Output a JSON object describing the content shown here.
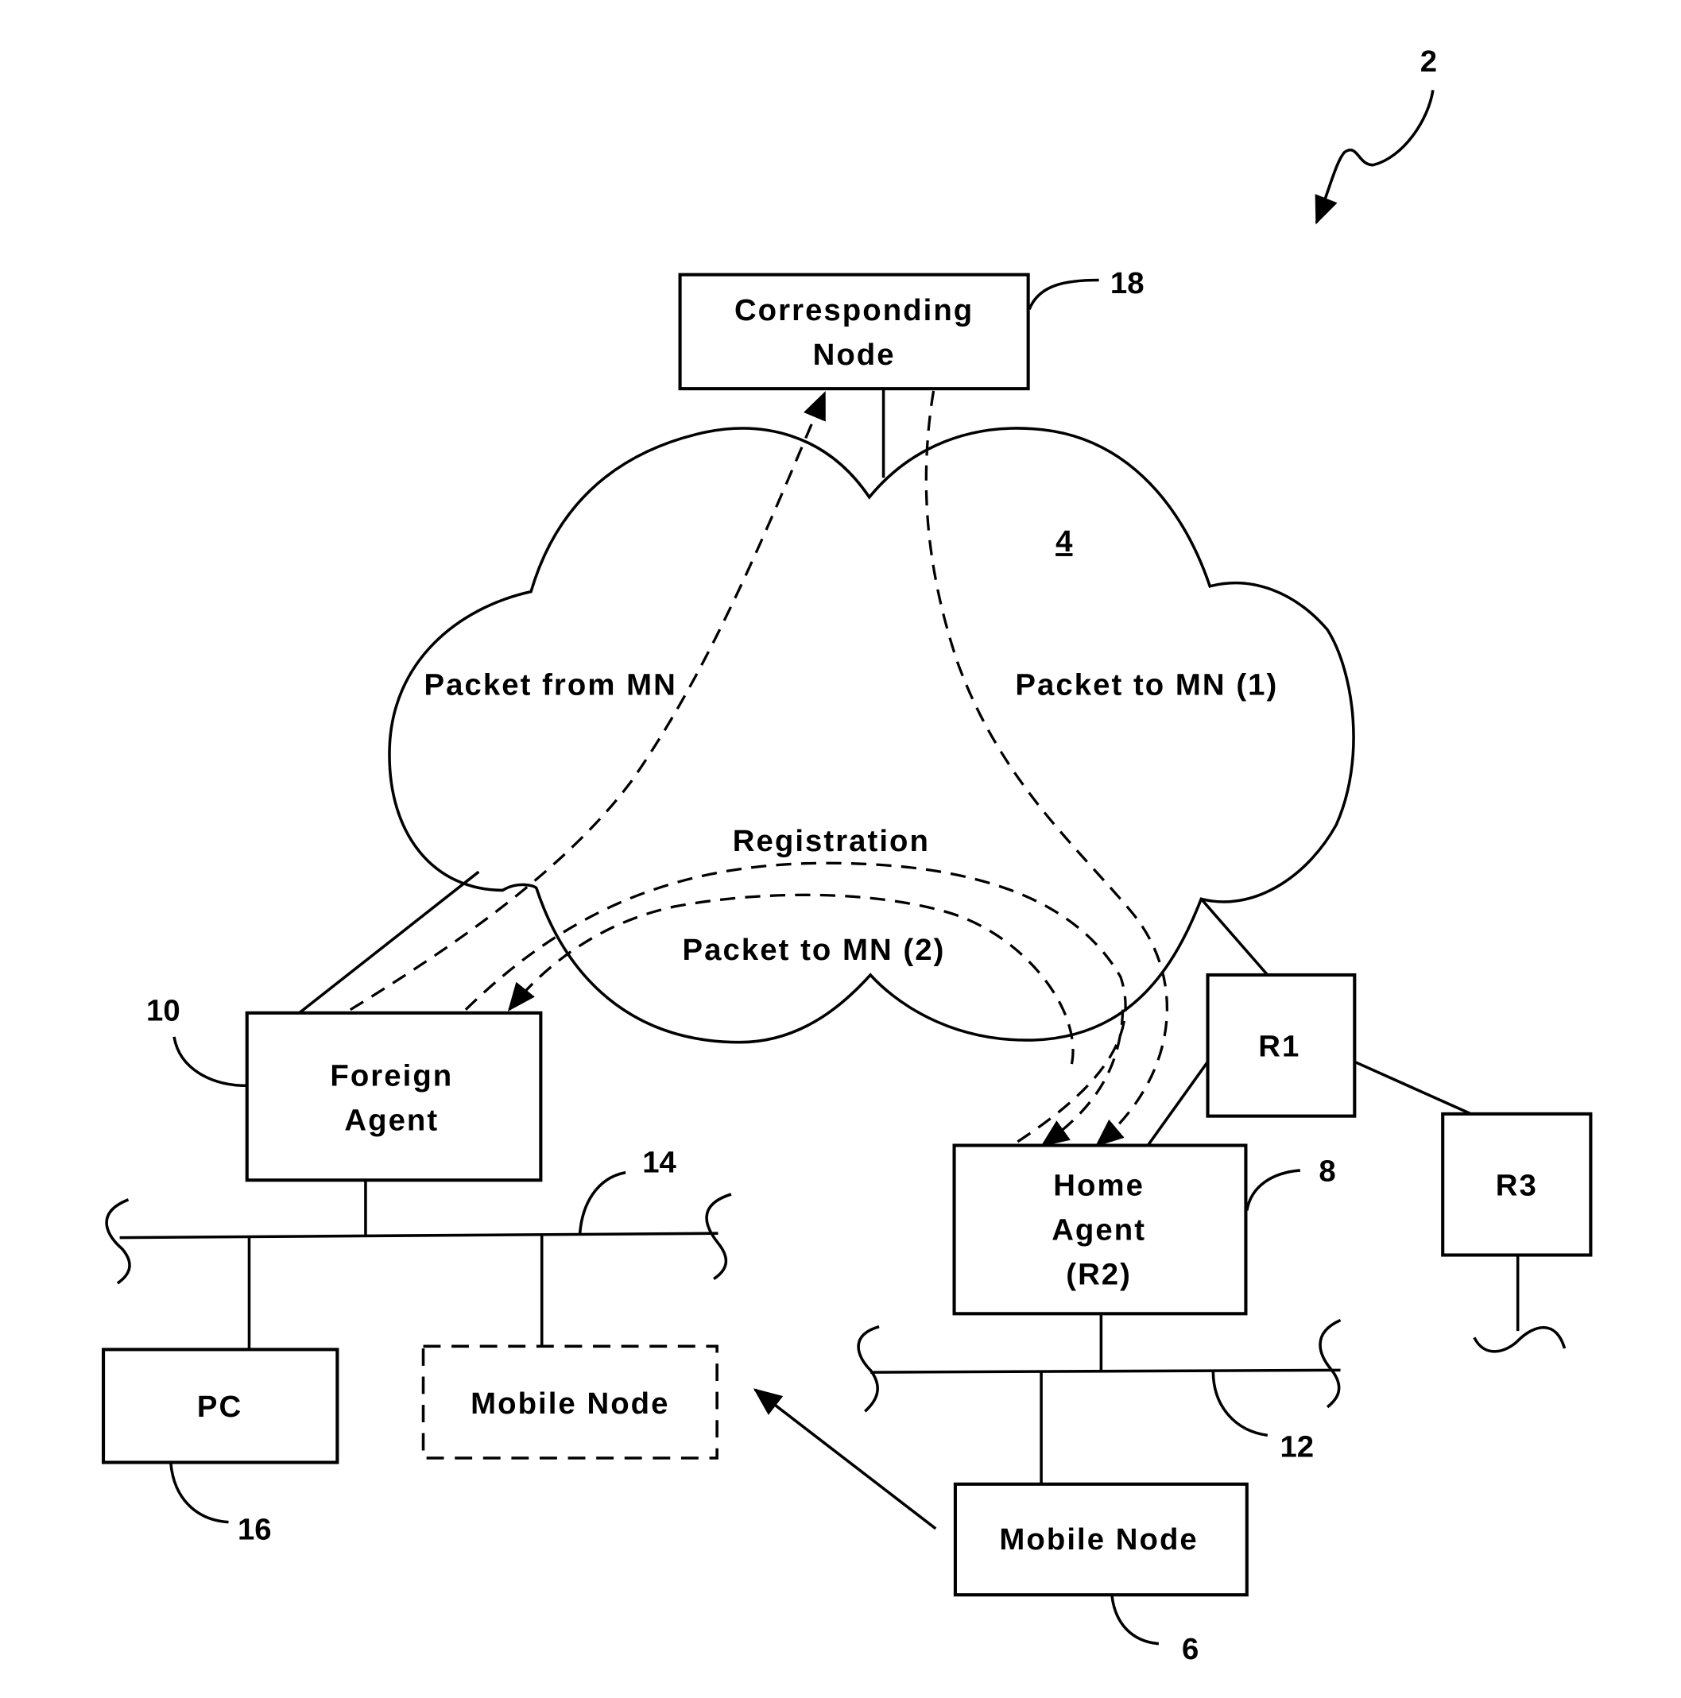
{
  "figure": {
    "ref_number": "2",
    "network": {
      "ref": "4"
    },
    "nodes": {
      "corresponding_node": {
        "line1": "Corresponding",
        "line2": "Node",
        "ref": "18"
      },
      "foreign_agent": {
        "line1": "Foreign",
        "line2": "Agent",
        "ref": "10"
      },
      "home_agent": {
        "line1": "Home",
        "line2": "Agent",
        "line3": "(R2)",
        "ref": "8"
      },
      "r1": {
        "label": "R1"
      },
      "r3": {
        "label": "R3"
      },
      "pc": {
        "label": "PC",
        "ref": "16"
      },
      "mobile_node_visiting": {
        "label": "Mobile Node"
      },
      "mobile_node_home": {
        "label": "Mobile Node",
        "ref": "6"
      }
    },
    "segments": {
      "foreign_lan": {
        "ref": "14"
      },
      "home_lan": {
        "ref": "12"
      }
    },
    "flows": {
      "packet_from_mn": "Packet from MN",
      "packet_to_mn_1": "Packet to MN (1)",
      "registration": "Registration",
      "packet_to_mn_2": "Packet to MN (2)"
    }
  }
}
